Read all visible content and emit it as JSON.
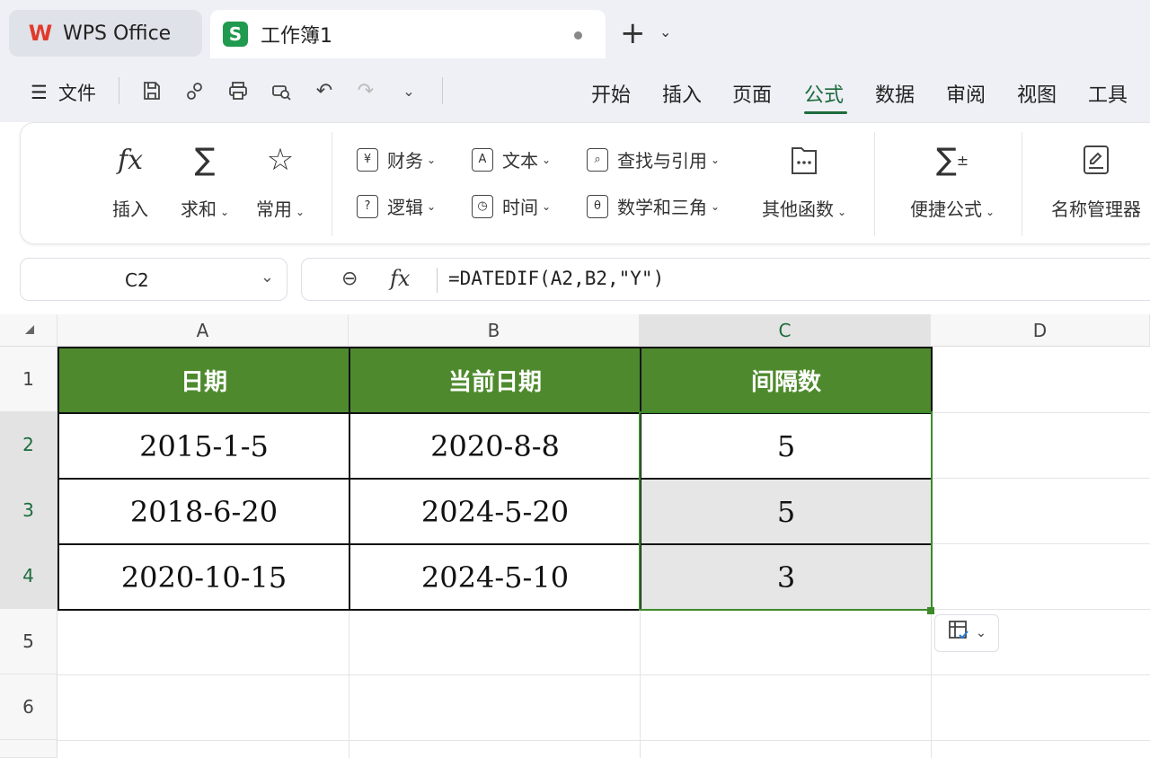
{
  "tabs": {
    "app": "WPS Office",
    "workbook": "工作簿1"
  },
  "menubar": {
    "file_label": "文件",
    "nav": [
      "开始",
      "插入",
      "页面",
      "公式",
      "数据",
      "审阅",
      "视图",
      "工具"
    ],
    "active_nav": "公式"
  },
  "ribbon": {
    "insert": "插入",
    "sum": "求和",
    "common": "常用",
    "finance": "财务",
    "logic": "逻辑",
    "text": "文本",
    "time": "时间",
    "lookup": "查找与引用",
    "math": "数学和三角",
    "other": "其他函数",
    "quick_formula": "便捷公式",
    "name_manager": "名称管理器"
  },
  "formula_bar": {
    "cell_ref": "C2",
    "fx": "fx",
    "formula": "=DATEDIF(A2,B2,\"Y\")"
  },
  "sheet": {
    "columns": [
      "A",
      "B",
      "C",
      "D"
    ],
    "rows": [
      "1",
      "2",
      "3",
      "4",
      "5",
      "6"
    ],
    "header": [
      "日期",
      "当前日期",
      "间隔数"
    ],
    "data": [
      [
        "2015-1-5",
        "2020-8-8",
        "5"
      ],
      [
        "2018-6-20",
        "2024-5-20",
        "5"
      ],
      [
        "2020-10-15",
        "2024-5-10",
        "3"
      ]
    ],
    "header_color": "#4e8a2d",
    "selection_color": "#3d8a2a"
  }
}
